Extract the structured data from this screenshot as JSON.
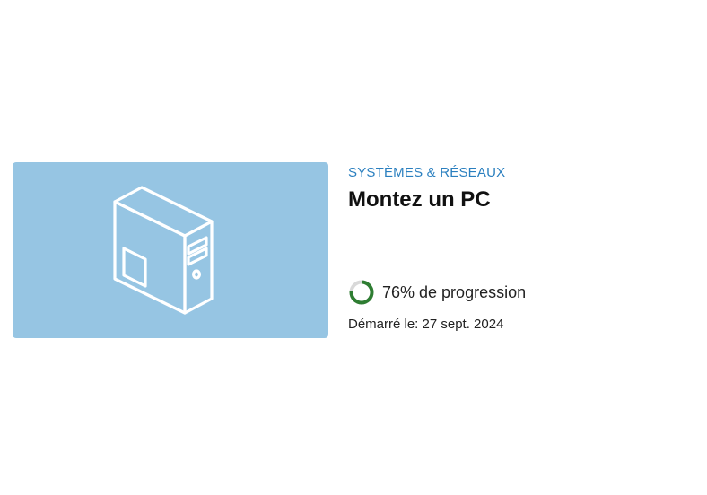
{
  "course": {
    "category": "SYSTÈMES & RÉSEAUX",
    "title": "Montez un PC",
    "progress_fraction": 0.76,
    "progress_text": "76% de progression",
    "started_text": "Démarré le: 27 sept. 2024",
    "thumbnail_icon": "pc-tower-icon"
  },
  "colors": {
    "thumbnail_bg": "#96c5e3",
    "category_text": "#2a7fbf",
    "progress_ring": "#2e7d32",
    "progress_track": "#d9d9d9"
  }
}
